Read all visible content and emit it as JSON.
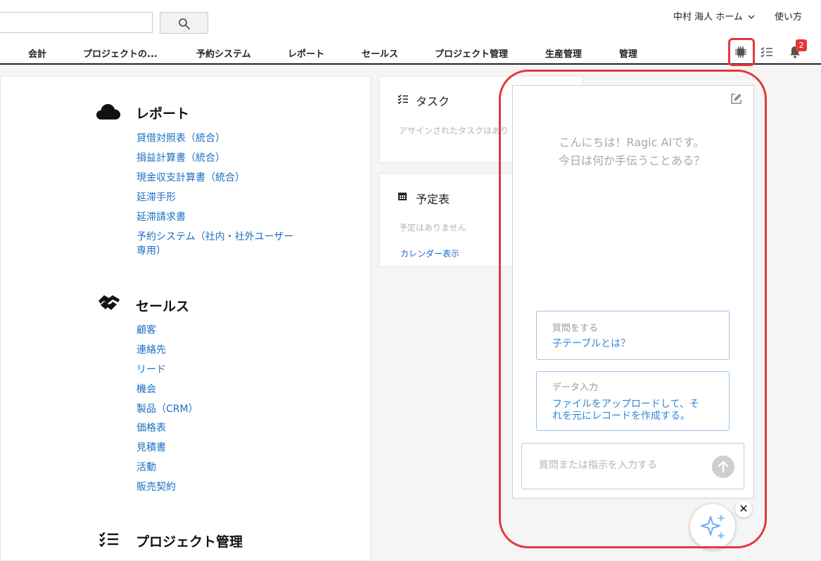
{
  "header": {
    "search": {
      "value": "",
      "placeholder": ""
    },
    "user_menu": "中村 海人 ホーム",
    "help": "使い方",
    "nav": [
      "会計",
      "プロジェクトの...",
      "予約システム",
      "レポート",
      "セールス",
      "プロジェクト管理",
      "生産管理",
      "管理"
    ],
    "notification_count": "2",
    "colors": {
      "highlight": "#e5383b",
      "link": "#1a6fc4",
      "badge": "#e53935"
    }
  },
  "left": {
    "sections": [
      {
        "title": "レポート",
        "icon": "cloud-icon",
        "links": [
          "貸借対照表（統合）",
          "損益計算書（統合）",
          "現金収支計算書（統合）",
          "延滞手形",
          "延滞請求書",
          "予約システム（社内・社外ユーザー",
          "専用）"
        ]
      },
      {
        "title": "セールス",
        "icon": "handshake-icon",
        "links": [
          "顧客",
          "連絡先",
          "リード",
          "機会",
          "製品（CRM）",
          "価格表",
          "見積書",
          "活動",
          "販売契約"
        ]
      },
      {
        "title": "プロジェクト管理",
        "icon": "checklist-icon",
        "links": []
      }
    ]
  },
  "widgets": {
    "tasks": {
      "title": "タスク",
      "empty": "アサインされたタスクはあり"
    },
    "schedule": {
      "title": "予定表",
      "empty": "予定はありません",
      "link": "カレンダー表示"
    }
  },
  "ai_chat": {
    "greeting_line1": "こんにちは！Ragic AIです。",
    "greeting_line2": "今日は何か手伝うことある？",
    "suggestions": [
      {
        "label": "質問をする",
        "text": "子テーブルとは？"
      },
      {
        "label": "データ入力",
        "text_line1": "ファイルをアップロードして、そ",
        "text_line2": "れを元にレコードを作成する。"
      }
    ],
    "input_placeholder": "質問または指示を入力する",
    "close": "✕"
  }
}
